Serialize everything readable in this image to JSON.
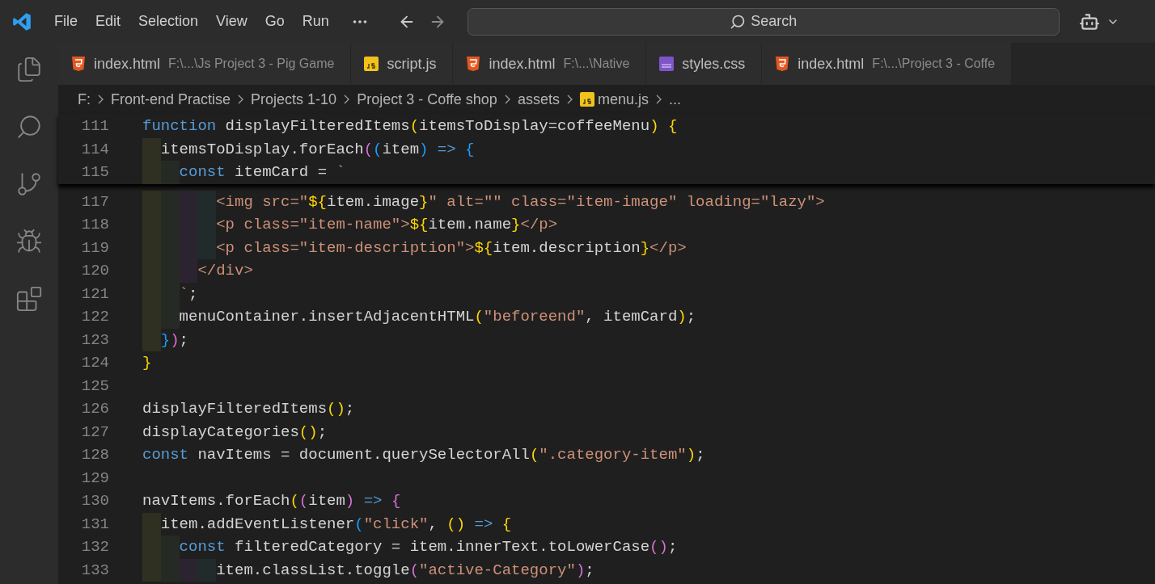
{
  "menu": [
    "File",
    "Edit",
    "Selection",
    "View",
    "Go",
    "Run"
  ],
  "search": {
    "label": "Search"
  },
  "tabs": [
    {
      "kind": "html",
      "label": "index.html",
      "path": "F:\\...\\Js Project 3 - Pig Game"
    },
    {
      "kind": "js",
      "label": "script.js"
    },
    {
      "kind": "html",
      "label": "index.html",
      "path": "F:\\...\\Native"
    },
    {
      "kind": "css",
      "label": "styles.css"
    },
    {
      "kind": "html",
      "label": "index.html",
      "path": "F:\\...\\Project 3 - Coffe"
    }
  ],
  "breadcrumb": [
    {
      "kind": "folder",
      "label": "F:"
    },
    {
      "kind": "folder",
      "label": "Front-end Practise"
    },
    {
      "kind": "folder",
      "label": "Projects 1-10"
    },
    {
      "kind": "folder",
      "label": "Project 3 - Coffe shop"
    },
    {
      "kind": "folder",
      "label": "assets"
    },
    {
      "kind": "js",
      "label": "menu.js"
    },
    {
      "kind": "more",
      "label": "..."
    }
  ],
  "sticky_lines": [
    {
      "number": "111",
      "tokens": [
        {
          "kind": "kw",
          "text": "function"
        },
        {
          "kind": "plain",
          "text": " displayFilteredItems"
        },
        {
          "kind": "b1",
          "text": "("
        },
        {
          "kind": "plain",
          "text": "itemsToDisplay=coffeeMenu"
        },
        {
          "kind": "b1",
          "text": ")"
        },
        {
          "kind": "b1",
          "text": " {"
        }
      ]
    },
    {
      "number": "114",
      "tokens": [
        {
          "kind": "plain",
          "text": "  itemsToDisplay.forEach"
        },
        {
          "kind": "b2",
          "text": "("
        },
        {
          "kind": "b3",
          "text": "("
        },
        {
          "kind": "plain",
          "text": "item"
        },
        {
          "kind": "b3",
          "text": ")"
        },
        {
          "kind": "kw",
          "text": " =>"
        },
        {
          "kind": "b3",
          "text": " {"
        }
      ]
    },
    {
      "number": "115",
      "tokens": [
        {
          "kind": "kw",
          "text": "    const"
        },
        {
          "kind": "plain",
          "text": " itemCard = "
        },
        {
          "kind": "str",
          "text": "`"
        }
      ]
    }
  ],
  "lines": [
    {
      "number": "117",
      "tokens": [
        {
          "kind": "str",
          "text": "        <img src=\""
        },
        {
          "kind": "b1",
          "text": "${"
        },
        {
          "kind": "plain",
          "text": "item.image"
        },
        {
          "kind": "b1",
          "text": "}"
        },
        {
          "kind": "str",
          "text": "\" alt=\"\" class=\"item-image\" loading=\"lazy\">"
        }
      ]
    },
    {
      "number": "118",
      "tokens": [
        {
          "kind": "str",
          "text": "        <p class=\"item-name\">"
        },
        {
          "kind": "b1",
          "text": "${"
        },
        {
          "kind": "plain",
          "text": "item.name"
        },
        {
          "kind": "b1",
          "text": "}"
        },
        {
          "kind": "str",
          "text": "</p>"
        }
      ]
    },
    {
      "number": "119",
      "tokens": [
        {
          "kind": "str",
          "text": "        <p class=\"item-description\">"
        },
        {
          "kind": "b1",
          "text": "${"
        },
        {
          "kind": "plain",
          "text": "item.description"
        },
        {
          "kind": "b1",
          "text": "}"
        },
        {
          "kind": "str",
          "text": "</p>"
        }
      ]
    },
    {
      "number": "120",
      "tokens": [
        {
          "kind": "str",
          "text": "      </div>"
        }
      ]
    },
    {
      "number": "121",
      "tokens": [
        {
          "kind": "str",
          "text": "    `"
        },
        {
          "kind": "plain",
          "text": ";"
        }
      ]
    },
    {
      "number": "122",
      "tokens": [
        {
          "kind": "plain",
          "text": "    menuContainer.insertAdjacentHTML"
        },
        {
          "kind": "b1",
          "text": "("
        },
        {
          "kind": "str",
          "text": "\"beforeend\""
        },
        {
          "kind": "plain",
          "text": ", itemCard"
        },
        {
          "kind": "b1",
          "text": ")"
        },
        {
          "kind": "plain",
          "text": ";"
        }
      ]
    },
    {
      "number": "123",
      "tokens": [
        {
          "kind": "b3",
          "text": "  }"
        },
        {
          "kind": "b2",
          "text": ")"
        },
        {
          "kind": "plain",
          "text": ";"
        }
      ]
    },
    {
      "number": "124",
      "tokens": [
        {
          "kind": "b1",
          "text": "}"
        }
      ]
    },
    {
      "number": "125"
    },
    {
      "number": "126",
      "tokens": [
        {
          "kind": "plain",
          "text": "displayFilteredItems"
        },
        {
          "kind": "b1",
          "text": "()"
        },
        {
          "kind": "plain",
          "text": ";"
        }
      ]
    },
    {
      "number": "127",
      "tokens": [
        {
          "kind": "plain",
          "text": "displayCategories"
        },
        {
          "kind": "b1",
          "text": "()"
        },
        {
          "kind": "plain",
          "text": ";"
        }
      ]
    },
    {
      "number": "128",
      "tokens": [
        {
          "kind": "kw",
          "text": "const"
        },
        {
          "kind": "plain",
          "text": " navItems = document.querySelectorAll"
        },
        {
          "kind": "b1",
          "text": "("
        },
        {
          "kind": "str",
          "text": "\".category-item\""
        },
        {
          "kind": "b1",
          "text": ")"
        },
        {
          "kind": "plain",
          "text": ";"
        }
      ]
    },
    {
      "number": "129"
    },
    {
      "number": "130",
      "tokens": [
        {
          "kind": "plain",
          "text": "navItems.forEach"
        },
        {
          "kind": "b1",
          "text": "("
        },
        {
          "kind": "b2",
          "text": "("
        },
        {
          "kind": "plain",
          "text": "item"
        },
        {
          "kind": "b2",
          "text": ")"
        },
        {
          "kind": "kw",
          "text": " =>"
        },
        {
          "kind": "b2",
          "text": " {"
        }
      ]
    },
    {
      "number": "131",
      "tokens": [
        {
          "kind": "plain",
          "text": "  item.addEventListener"
        },
        {
          "kind": "b3",
          "text": "("
        },
        {
          "kind": "str",
          "text": "\"click\""
        },
        {
          "kind": "plain",
          "text": ", "
        },
        {
          "kind": "b1",
          "text": "()"
        },
        {
          "kind": "kw",
          "text": " =>"
        },
        {
          "kind": "b1",
          "text": " {"
        }
      ]
    },
    {
      "number": "132",
      "tokens": [
        {
          "kind": "kw",
          "text": "    const"
        },
        {
          "kind": "plain",
          "text": " filteredCategory = item.innerText.toLowerCase"
        },
        {
          "kind": "b2",
          "text": "()"
        },
        {
          "kind": "plain",
          "text": ";"
        }
      ]
    },
    {
      "number": "133",
      "tokens": [
        {
          "kind": "plain",
          "text": "        item.classList.toggle"
        },
        {
          "kind": "b2",
          "text": "("
        },
        {
          "kind": "str",
          "text": "\"active-Category\""
        },
        {
          "kind": "b2",
          "text": ")"
        },
        {
          "kind": "plain",
          "text": ";"
        }
      ]
    }
  ]
}
